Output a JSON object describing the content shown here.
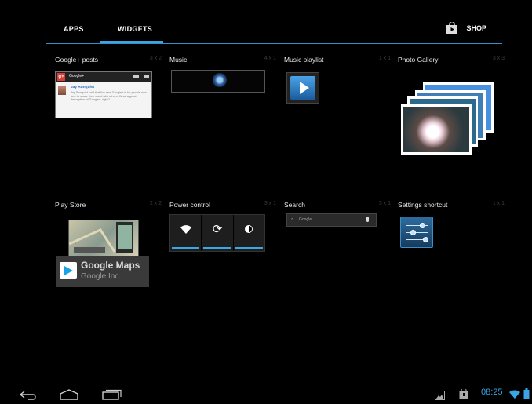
{
  "tabs": {
    "apps": "APPS",
    "widgets": "WIDGETS",
    "shop": "SHOP"
  },
  "widgets": [
    {
      "name": "Google+ posts",
      "size": "3 x 2"
    },
    {
      "name": "Music",
      "size": "4 x 1"
    },
    {
      "name": "Music playlist",
      "size": "1 x 1"
    },
    {
      "name": "Photo Gallery",
      "size": "3 x 3"
    },
    {
      "name": "Play Store",
      "size": "2 x 2"
    },
    {
      "name": "Power control",
      "size": "3 x 1"
    },
    {
      "name": "Search",
      "size": "3 x 1"
    },
    {
      "name": "Settings shortcut",
      "size": "1 x 1"
    }
  ],
  "gplus_preview": {
    "app": "Google+",
    "author": "Jay Runquist",
    "text": "Jay Runquist said that the new Google+ is for people who love to share their world with others. What a great description of Google+, right?"
  },
  "play_store_preview": {
    "title": "Google Maps",
    "developer": "Google Inc."
  },
  "search_preview": {
    "placeholder": "Google"
  },
  "status": {
    "time": "08:25"
  },
  "icons": {
    "shop": "shopping-bag-icon",
    "back": "back-icon",
    "home": "home-icon",
    "recents": "recent-apps-icon",
    "gallery_notification": "gallery-notification-icon",
    "download_notification": "download-notification-icon",
    "wifi": "wifi-icon",
    "battery": "battery-icon"
  },
  "colors": {
    "accent": "#3aa6e4",
    "background": "#000000"
  }
}
